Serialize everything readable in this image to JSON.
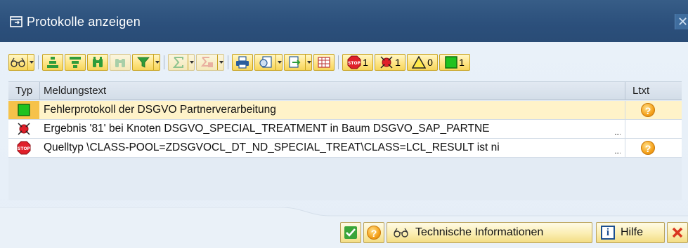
{
  "window": {
    "title": "Protokolle anzeigen",
    "close_glyph": "✕"
  },
  "toolbar": {
    "counts": {
      "stop": "1",
      "error": "1",
      "warning": "0",
      "success": "1"
    }
  },
  "table": {
    "columns": [
      "Typ",
      "Meldungstext",
      "Ltxt"
    ],
    "rows": [
      {
        "type": "success",
        "text": "Fehlerprotokoll der DSGVO Partnerverarbeitung",
        "ltxt": true,
        "selected": true
      },
      {
        "type": "error",
        "text": "Ergebnis '81' bei Knoten DSGVO_SPECIAL_TREATMENT in Baum DSGVO_SAP_PARTNE",
        "ltxt": false,
        "selected": false
      },
      {
        "type": "stop",
        "text": "Quelltyp \\CLASS-POOL=ZDSGVOCL_DT_ND_SPECIAL_TREAT\\CLASS=LCL_RESULT ist ni",
        "ltxt": true,
        "selected": false
      }
    ],
    "ltxt_glyph": "?"
  },
  "footer": {
    "tech_info_label": "Technische Informationen",
    "help_label": "Hilfe",
    "help_glyph": "?",
    "info_glyph": "i"
  },
  "colors": {
    "titlebar": "#2b4f7b",
    "button_fill": "#ffe68a",
    "selected_row": "#fff3c9",
    "stop_red": "#e0202a",
    "success_green": "#1fc21f"
  }
}
